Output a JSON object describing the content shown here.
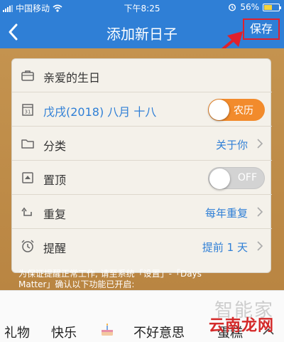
{
  "status_bar": {
    "carrier": "中国移动",
    "time": "下午8:25",
    "battery": "56%",
    "battery_level": 0.56
  },
  "nav": {
    "title": "添加新日子",
    "save_label": "保存"
  },
  "form": {
    "name": "亲爱的生日",
    "date": "戊戌(2018) 八月 十八",
    "lunar_toggle": {
      "label": "农历",
      "on": true
    },
    "category": {
      "label": "分类",
      "value": "关于你"
    },
    "pin_top": {
      "label": "置顶",
      "toggle_label": "OFF",
      "on": false
    },
    "repeat": {
      "label": "重复",
      "value": "每年重复"
    },
    "reminder": {
      "label": "提醒",
      "value": "提前 1 天"
    }
  },
  "notice": {
    "line1": "为保证提醒正常工作, 请至系统「设置」-「Days",
    "line2": "Matter」确认以下功能已开启:"
  },
  "keyboard": {
    "candidates": [
      "礼物",
      "快乐",
      "不好意思",
      "蛋糕"
    ]
  },
  "watermark": {
    "line1": "智能家",
    "line2": "云南龙网"
  },
  "colors": {
    "primary": "#2f7fd6",
    "accent_orange": "#f28b2c",
    "annotation_red": "#e0202c",
    "background_wood": "#c4934f"
  }
}
